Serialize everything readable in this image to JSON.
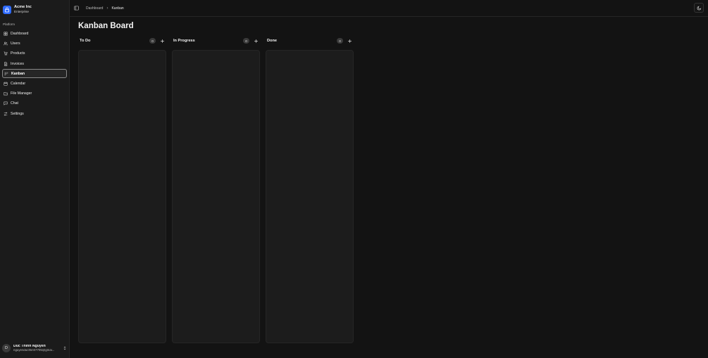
{
  "brand": {
    "name": "Acme Inc",
    "plan": "Enterprise"
  },
  "sidebar": {
    "section_label": "Platform",
    "items": [
      {
        "label": "Dashboard",
        "icon": "dashboard-icon",
        "active": false
      },
      {
        "label": "Users",
        "icon": "users-icon",
        "active": false
      },
      {
        "label": "Products",
        "icon": "cart-icon",
        "active": false
      },
      {
        "label": "Invoices",
        "icon": "invoice-icon",
        "active": false
      },
      {
        "label": "Kanban",
        "icon": "kanban-icon",
        "active": true
      },
      {
        "label": "Calendar",
        "icon": "calendar-icon",
        "active": false
      },
      {
        "label": "File Manager",
        "icon": "folder-icon",
        "active": false
      },
      {
        "label": "Chat",
        "icon": "chat-icon",
        "active": false
      },
      {
        "label": "Settings",
        "icon": "settings-icon",
        "active": false
      }
    ]
  },
  "user": {
    "initial": "D",
    "name": "Duc Thinh Nguyen",
    "email": "nguyenducthinh7705@gmai..."
  },
  "breadcrumb": {
    "parent": "Dashboard",
    "current": "Kanban"
  },
  "page": {
    "title": "Kanban Board"
  },
  "board": {
    "columns": [
      {
        "title": "To Do",
        "count": "0"
      },
      {
        "title": "In Progress",
        "count": "0"
      },
      {
        "title": "Done",
        "count": "0"
      }
    ]
  },
  "colors": {
    "accent": "#2f6bff",
    "background": "#131313",
    "sidebar": "#1b1b1b",
    "column": "#1c1c1c"
  }
}
